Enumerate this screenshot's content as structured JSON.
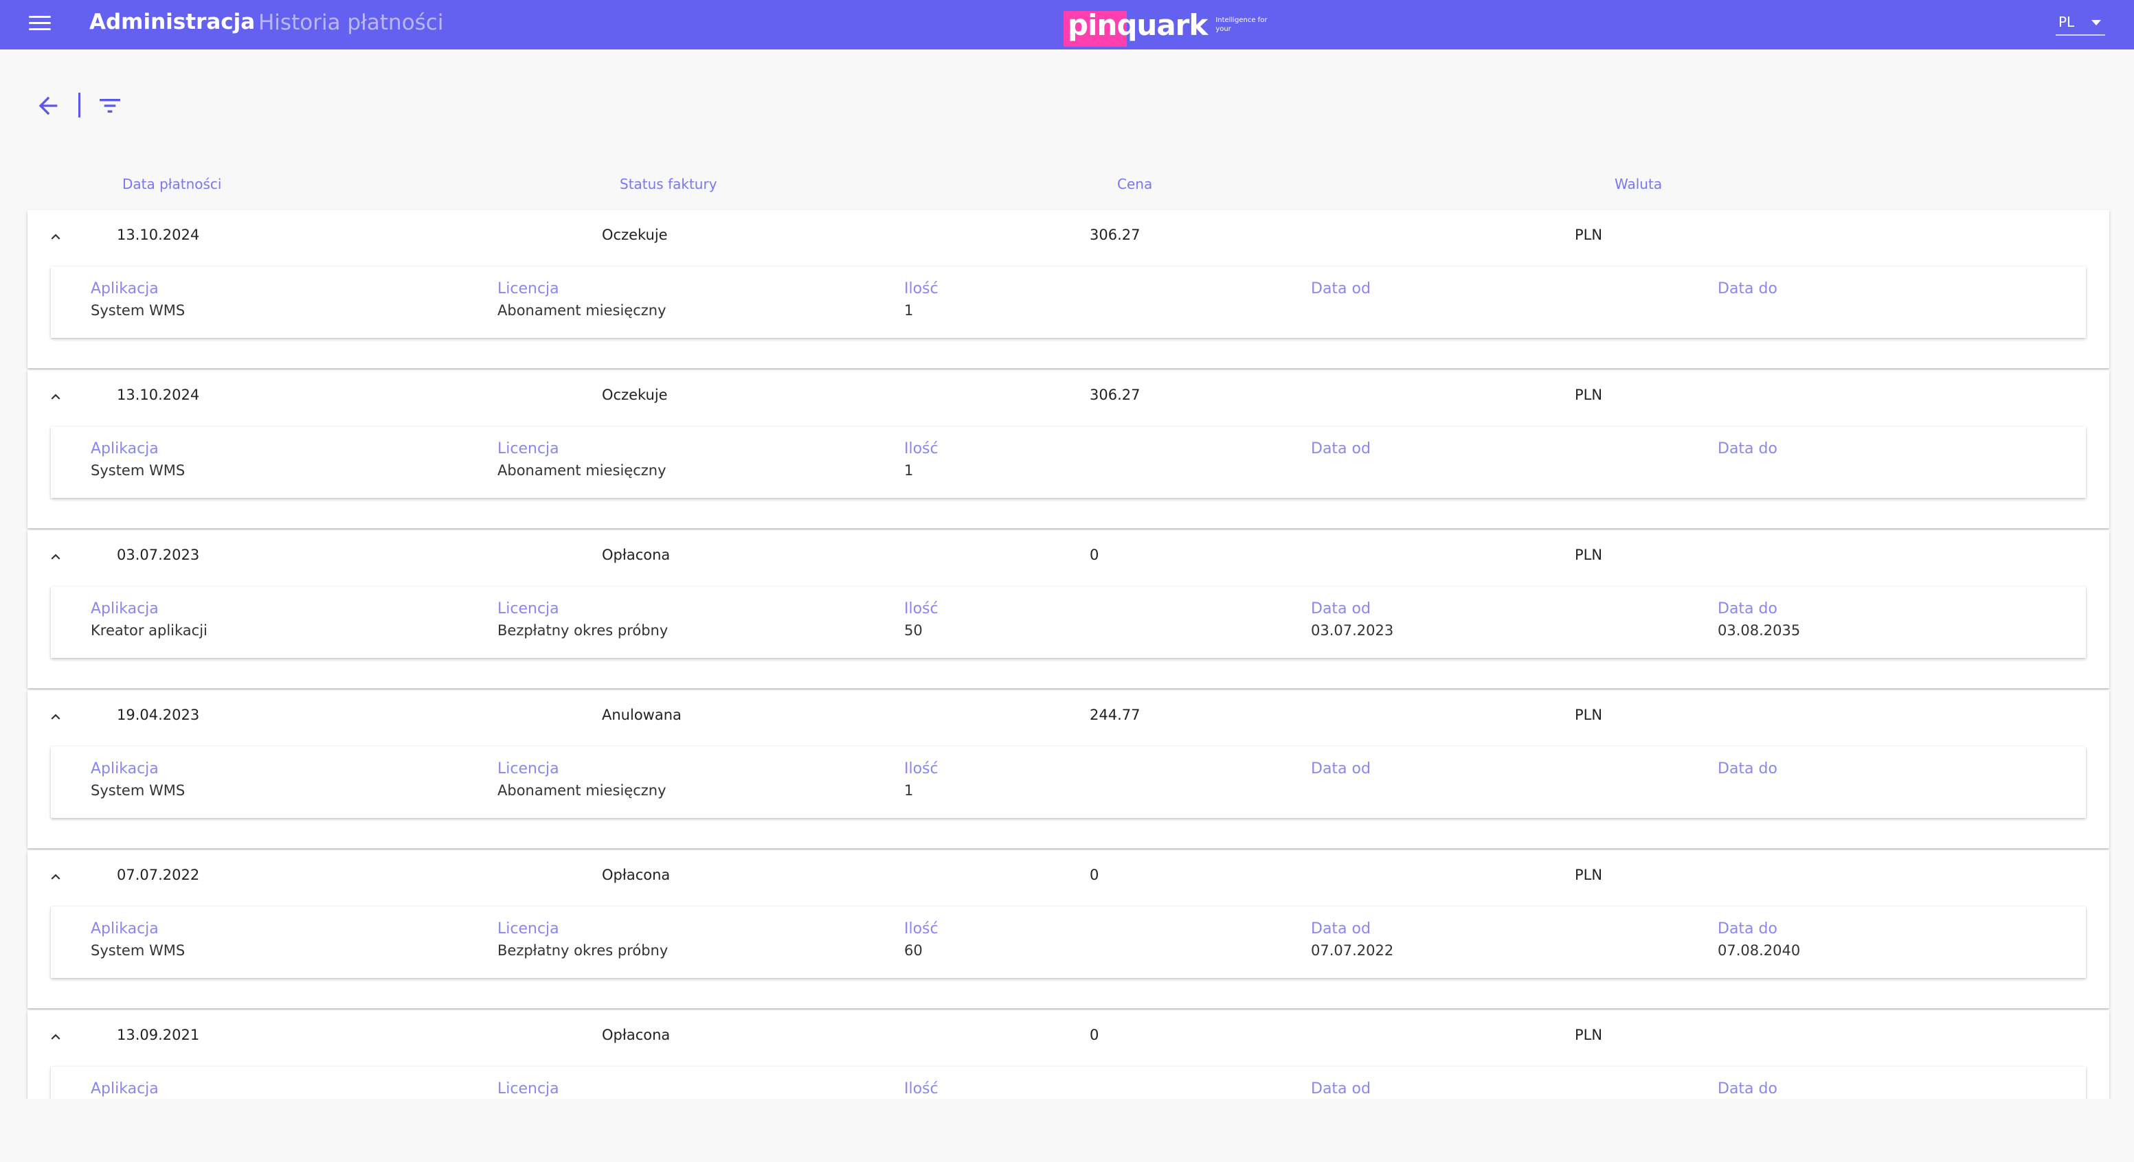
{
  "header": {
    "title": "Administracja",
    "subtitle": "Historia płatności",
    "logo_text": "pinquark",
    "logo_tagline": "Intelligence for your",
    "language": "PL",
    "colors": {
      "bar": "#6461f0",
      "logo_accent": "#ff3fae"
    }
  },
  "toolbar": {
    "back_icon": "arrow-back-icon",
    "filter_icon": "filter-icon"
  },
  "columns": {
    "date": "Data płatności",
    "status": "Status faktury",
    "price": "Cena",
    "currency": "Waluta"
  },
  "detail_labels": {
    "app": "Aplikacja",
    "license": "Licencja",
    "qty": "Ilość",
    "from": "Data od",
    "to": "Data do"
  },
  "payments": [
    {
      "date": "13.10.2024",
      "status": "Oczekuje",
      "price": "306.27",
      "currency": "PLN",
      "app": "System WMS",
      "license": "Abonament miesięczny",
      "qty": "1",
      "from": "",
      "to": ""
    },
    {
      "date": "13.10.2024",
      "status": "Oczekuje",
      "price": "306.27",
      "currency": "PLN",
      "app": "System WMS",
      "license": "Abonament miesięczny",
      "qty": "1",
      "from": "",
      "to": ""
    },
    {
      "date": "03.07.2023",
      "status": "Opłacona",
      "price": "0",
      "currency": "PLN",
      "app": "Kreator aplikacji",
      "license": "Bezpłatny okres próbny",
      "qty": "50",
      "from": "03.07.2023",
      "to": "03.08.2035"
    },
    {
      "date": "19.04.2023",
      "status": "Anulowana",
      "price": "244.77",
      "currency": "PLN",
      "app": "System WMS",
      "license": "Abonament miesięczny",
      "qty": "1",
      "from": "",
      "to": ""
    },
    {
      "date": "07.07.2022",
      "status": "Opłacona",
      "price": "0",
      "currency": "PLN",
      "app": "System WMS",
      "license": "Bezpłatny okres próbny",
      "qty": "60",
      "from": "07.07.2022",
      "to": "07.08.2040"
    },
    {
      "date": "13.09.2021",
      "status": "Opłacona",
      "price": "0",
      "currency": "PLN",
      "app": "",
      "license": "",
      "qty": "",
      "from": "",
      "to": ""
    }
  ]
}
